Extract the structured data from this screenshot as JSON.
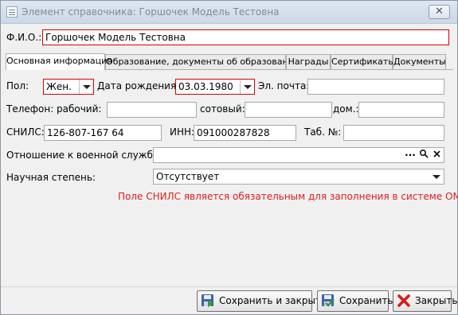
{
  "window": {
    "title": "Элемент справочника: Горшочек Модель Тестовна",
    "close_label": "✕"
  },
  "fio": {
    "label": "Ф.И.О.:",
    "value": "Горшочек Модель Тестовна"
  },
  "tabs": [
    {
      "label": "Основная информация",
      "active": true
    },
    {
      "label": "Образование, документы об образовании",
      "active": false
    },
    {
      "label": "Награды",
      "active": false
    },
    {
      "label": "Сертификаты",
      "active": false
    },
    {
      "label": "Документы",
      "active": false
    }
  ],
  "form": {
    "gender": {
      "label": "Пол:",
      "value": "Жен."
    },
    "birth_date": {
      "label": "Дата рождения:",
      "value": "03.03.1980"
    },
    "email": {
      "label": "Эл. почта:",
      "value": ""
    },
    "phone": {
      "label": "Телефон:",
      "work_label": "рабочий:",
      "work_value": "",
      "mobile_label": "сотовый:",
      "mobile_value": "",
      "home_label": "дом.:",
      "home_value": ""
    },
    "snils": {
      "label": "СНИЛС:",
      "value": "126-807-167 64"
    },
    "inn": {
      "label": "ИНН:",
      "value": "091000287828"
    },
    "tab_no": {
      "label": "Таб. №:",
      "value": ""
    },
    "military": {
      "label": "Отношение к военной службе:",
      "value": "",
      "more_label": "···"
    },
    "degree": {
      "label": "Научная степень:",
      "value": "Отсутствует"
    },
    "error": "Поле СНИЛС является обязательным для заполнения в системе ОМС!"
  },
  "footer": {
    "save_close_label": "Сохранить и закрыть",
    "save_label": "Сохранить",
    "close_label": "Закрыть"
  },
  "colors": {
    "required_border": "#d60000",
    "error_text": "#e01d1d"
  }
}
